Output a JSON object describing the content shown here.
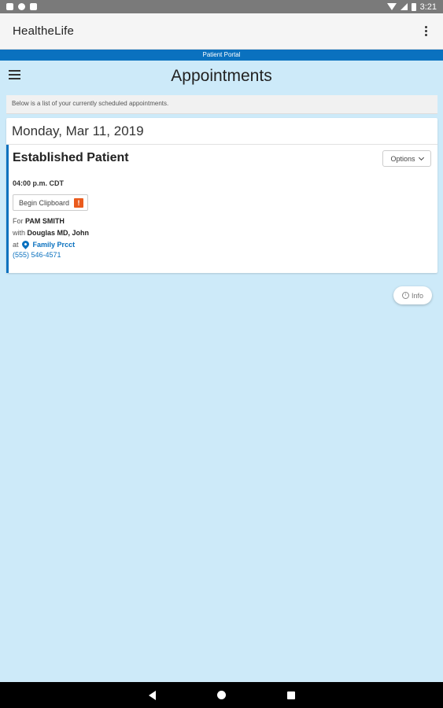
{
  "status_bar": {
    "time": "3:21"
  },
  "app_bar": {
    "title": "HealtheLife"
  },
  "portal_strip": {
    "label": "Patient Portal"
  },
  "header": {
    "title": "Appointments"
  },
  "notice": {
    "text": "Below is a list of your currently scheduled appointments."
  },
  "appointment": {
    "date": "Monday, Mar 11, 2019",
    "type": "Established Patient",
    "options_label": "Options",
    "time": "04:00 p.m. CDT",
    "clipboard_label": "Begin Clipboard",
    "alert_badge": "!",
    "for_prefix": "For",
    "patient": "PAM SMITH",
    "with_prefix": "with",
    "provider": "Douglas MD, John",
    "at_prefix": "at",
    "location": "Family Prcct",
    "phone": "(555) 546-4571"
  },
  "info_button": {
    "label": "Info"
  },
  "colors": {
    "portal_blue": "#0a71bf",
    "page_bg": "#cdeaf9",
    "alert_orange": "#ea5b1d"
  }
}
